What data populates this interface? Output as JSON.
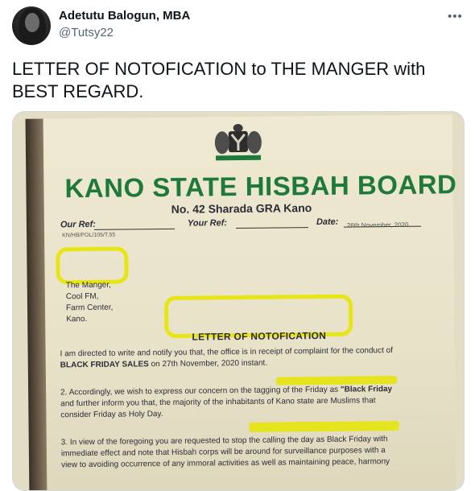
{
  "author": {
    "name": "Adetutu Balogun, MBA",
    "handle": "@Tutsy22"
  },
  "menu_icon": "more-horizontal-icon",
  "tweet_text": "LETTER OF NOTOFICATION to THE MANGER with BEST REGARD.",
  "document": {
    "board_title": "KANO STATE HISBAH BOARD",
    "address": "No. 42 Sharada GRA Kano",
    "our_ref_label": "Our Ref:",
    "our_ref_value": "KN/HB/POL/105/T.55",
    "your_ref_label": "Your Ref:",
    "date_label": "Date:",
    "date_value": "26th November, 2020",
    "recipient": [
      "The Manger,",
      "Cool FM,",
      "Farm Center,",
      "Kano."
    ],
    "letter_heading": "LETTER OF NOTOFICATION",
    "para1_text": "I am directed to write and notify you that, the office is in receipt of complaint for the conduct of",
    "para1_bold": "BLACK FRIDAY SALES",
    "para1_tail": "on 27th November, 2020 instant.",
    "para2_text": "2. Accordingly, we wish to express our concern on the tagging of the Friday as",
    "para2_bold": "\"Black Friday",
    "para2_line2": "and further inform you that, the majority of the inhabitants of Kano state are Muslims that",
    "para2_line3": "consider Friday as Holy Day.",
    "para3_line1": "3. In view of the foregoing you are requested to stop the calling the day as Black Friday with",
    "para3_line2": "immediate effect and note that Hisbah corps will be around for surveillance purposes with a",
    "para3_line3": "view to avoiding occurrence of any immoral activities as well as maintaining peace, harmony",
    "highlight_color": "#e7e600",
    "title_color": "#1d7a3a"
  }
}
